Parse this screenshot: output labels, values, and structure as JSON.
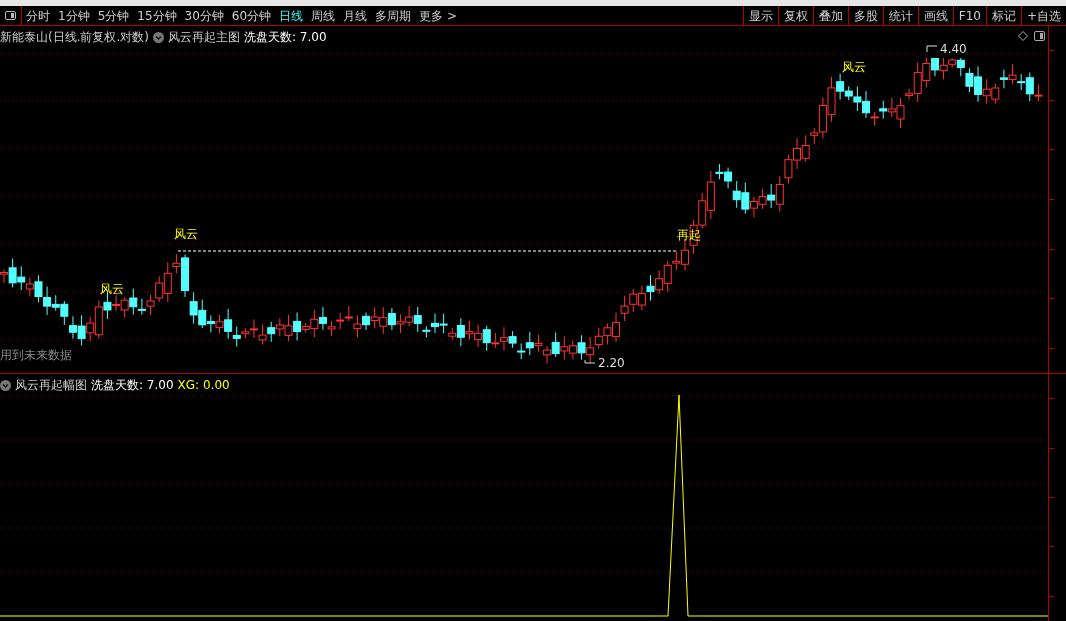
{
  "period_tabs": [
    {
      "label": "分时",
      "selected": false
    },
    {
      "label": "1分钟",
      "selected": false
    },
    {
      "label": "5分钟",
      "selected": false
    },
    {
      "label": "15分钟",
      "selected": false
    },
    {
      "label": "30分钟",
      "selected": false
    },
    {
      "label": "60分钟",
      "selected": false
    },
    {
      "label": "日线",
      "selected": true
    },
    {
      "label": "周线",
      "selected": false
    },
    {
      "label": "月线",
      "selected": false
    },
    {
      "label": "多周期",
      "selected": false
    },
    {
      "label": "更多 >",
      "selected": false
    }
  ],
  "toolbar_buttons": [
    "显示",
    "复权",
    "叠加",
    "多股",
    "统计",
    "画线",
    "F10",
    "标记",
    "+自选"
  ],
  "main_chart": {
    "stock_title": "新能泰山(日线.前复权.对数)",
    "indicator_name": "风云再起主图",
    "parameter": "洗盘天数: 7.00",
    "annotations": [
      {
        "kind": "signal",
        "text": "风云"
      },
      {
        "kind": "signal",
        "text": "风云"
      },
      {
        "kind": "signal",
        "text": "再起"
      },
      {
        "kind": "signal",
        "text": "风云"
      },
      {
        "kind": "high",
        "text": "4.40"
      },
      {
        "kind": "low",
        "text": "2.20"
      },
      {
        "kind": "warning",
        "text": "用到未来数据"
      }
    ]
  },
  "indicator_pane": {
    "indicator_name": "风云再起幅图",
    "parameter": "洗盘天数: 7.00",
    "output": "XG: 0.00"
  }
}
